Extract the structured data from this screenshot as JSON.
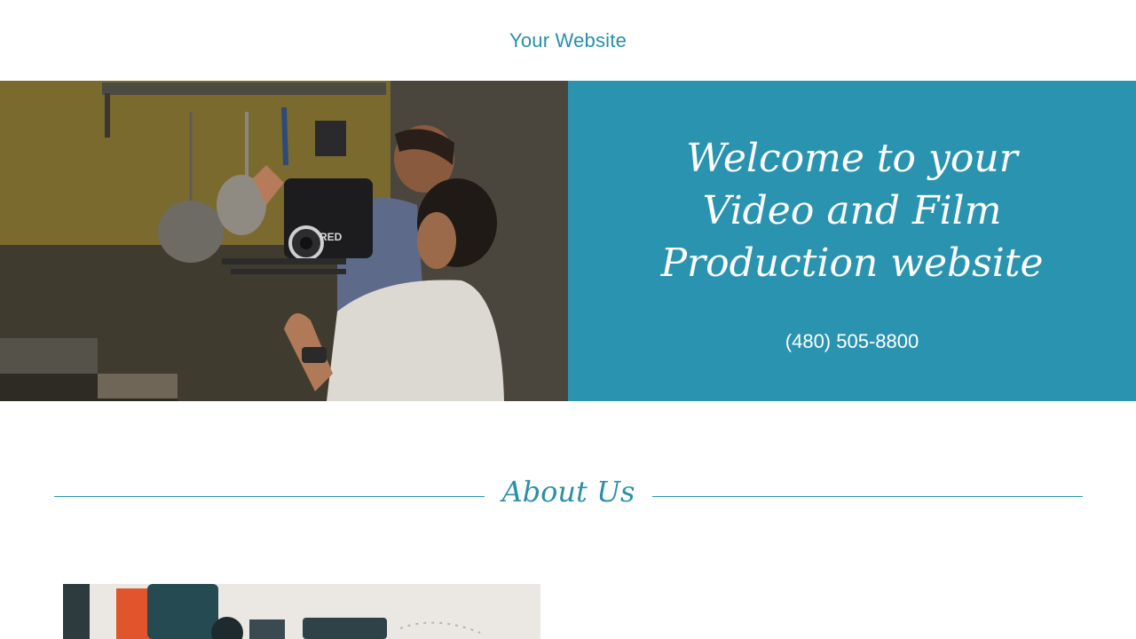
{
  "header": {
    "site_title": "Your Website"
  },
  "hero": {
    "heading": "Welcome to your Video and Film Production website",
    "phone": "(480) 505-8800",
    "panel_color": "#2a94b0",
    "image_alt": "Two men operating a RED cinema camera in a kitchen",
    "camera_brand_text": "RED"
  },
  "about": {
    "heading": "About Us",
    "image_alt": "Film production equipment"
  },
  "colors": {
    "accent": "#2a8fa9",
    "background": "#ffffff"
  }
}
